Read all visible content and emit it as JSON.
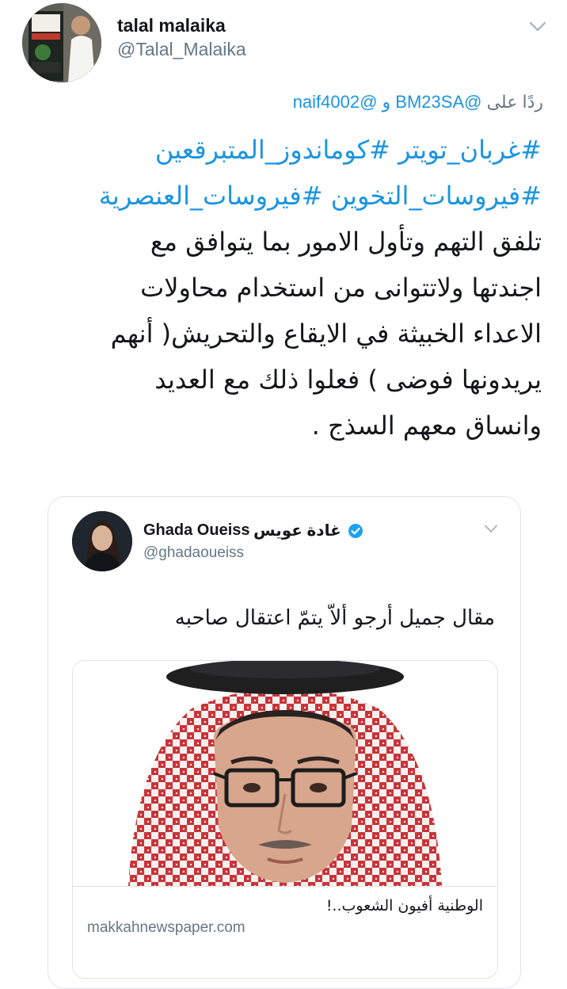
{
  "tweet": {
    "author_name": "talal malaika",
    "author_handle": "@Talal_Malaika",
    "reply_prefix": "ردًا على",
    "reply_mentions": "@BM23SA و @naif4002",
    "hashtag_lines": [
      "#غربان_تويتر #كوماندوز_المتبرقعين",
      "#فيروسات_التخوين #فيروسات_العنصرية"
    ],
    "text_lines": [
      "تلفق التهم وتأول الامور بما يتوافق مع",
      "اجندتها ولاتتوانى من استخدام محاولات",
      "الاعداء الخبيثة في الايقاع والتحريش( أنهم",
      "يريدونها فوضى )  فعلوا ذلك مع العديد",
      "وانساق معهم السذج ."
    ]
  },
  "quoted_tweet": {
    "author_name": "Ghada Oueiss",
    "author_name_arabic": "غادة عويس",
    "author_handle": "@ghadaoueiss",
    "text": "مقال جميل أرجو ألاّ يتمّ اعتقال صاحبه",
    "link_card": {
      "title": "الوطنية أفيون الشعوب..!",
      "domain": "makkahnewspaper.com"
    }
  },
  "icons": {
    "menu": "chevron-down-icon",
    "verified": "verified-badge-icon"
  },
  "colors": {
    "link_blue": "#1b95e0",
    "secondary_gray": "#657786",
    "verified_blue": "#1da1f2",
    "border": "#dfe4e8"
  }
}
